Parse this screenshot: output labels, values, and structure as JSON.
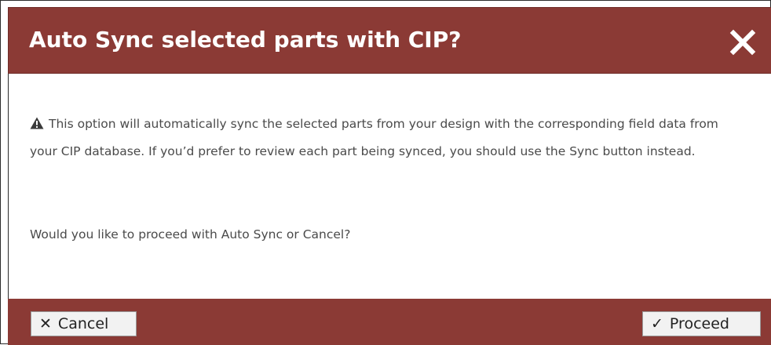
{
  "dialog": {
    "title": "Auto Sync selected parts with CIP?",
    "close_icon": "close-icon",
    "header_color": "#8b3a35"
  },
  "body": {
    "warning_icon": "warning-triangle-icon",
    "warning_text": "This option will automatically sync the selected parts from your design with the corresponding field data from your CIP database. If you’d prefer to review each part being synced, you should use the Sync button instead.",
    "question": "Would you like to proceed with Auto Sync or Cancel?"
  },
  "footer": {
    "cancel_glyph": "✕",
    "cancel_label": "Cancel",
    "proceed_glyph": "✓",
    "proceed_label": "Proceed"
  }
}
